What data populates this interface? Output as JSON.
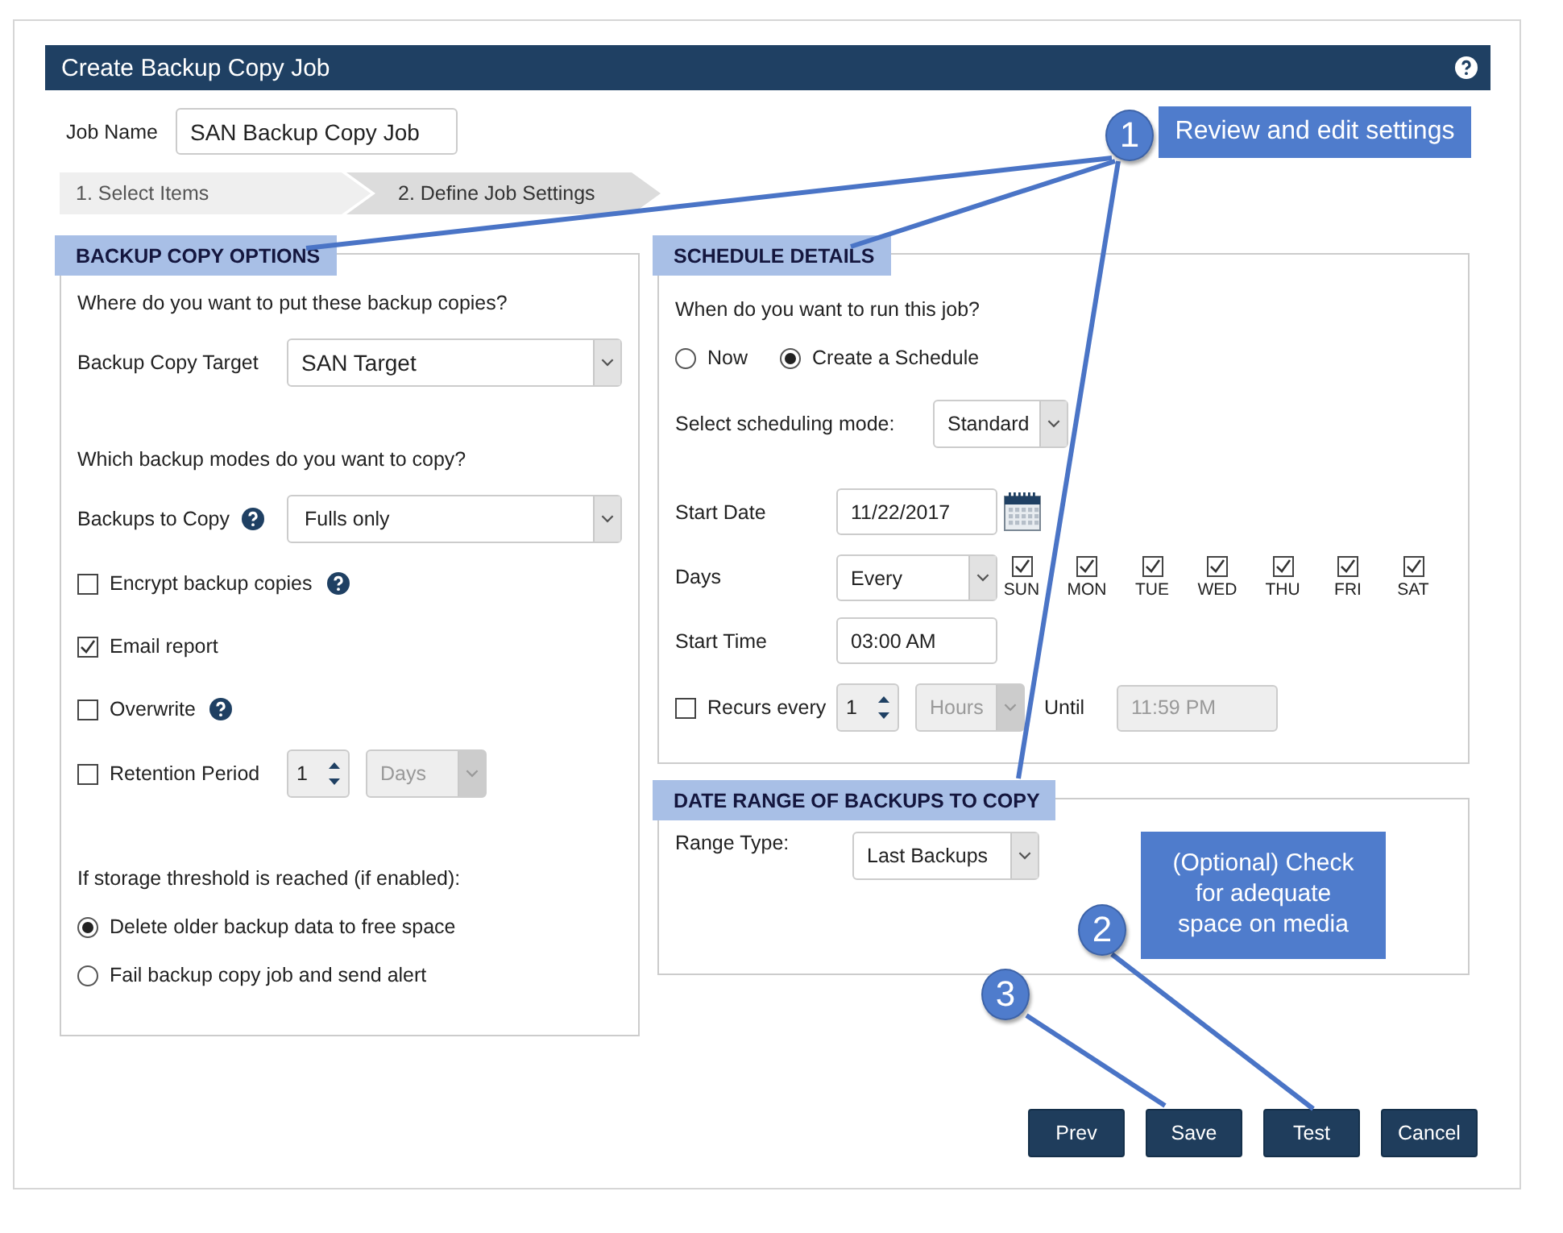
{
  "window": {
    "title": "Create Backup Copy Job"
  },
  "job_name": {
    "label": "Job Name",
    "value": "SAN Backup Copy Job"
  },
  "steps": [
    {
      "label": "1. Select Items",
      "selected": false
    },
    {
      "label": "2. Define Job Settings",
      "selected": true
    }
  ],
  "backup_copy_options": {
    "title": "BACKUP COPY OPTIONS",
    "target_question": "Where do you want to put these backup copies?",
    "target": {
      "label": "Backup Copy Target",
      "value": "SAN Target"
    },
    "modes_question": "Which backup modes do you want to copy?",
    "backups_to_copy": {
      "label": "Backups to Copy",
      "value": "Fulls only",
      "help": true
    },
    "options": [
      {
        "label": "Encrypt backup copies",
        "checked": false,
        "help": true
      },
      {
        "label": "Email report",
        "checked": true,
        "help": false
      },
      {
        "label": "Overwrite",
        "checked": false,
        "help": true
      }
    ],
    "retention": {
      "label": "Retention Period",
      "checked": false,
      "count": "1",
      "unit": "Days",
      "disabled": true
    },
    "threshold_question": "If storage threshold is reached (if enabled):",
    "threshold_choices": [
      {
        "label": "Delete older backup data to free space",
        "selected": true
      },
      {
        "label": "Fail backup copy job and send alert",
        "selected": false
      }
    ]
  },
  "schedule_details": {
    "title": "SCHEDULE DETAILS",
    "question": "When do you want to run this job?",
    "run_choices": [
      {
        "label": "Now",
        "selected": false
      },
      {
        "label": "Create a Schedule",
        "selected": true
      }
    ],
    "mode": {
      "label": "Select scheduling mode:",
      "value": "Standard"
    },
    "start_date": {
      "label": "Start Date",
      "value": "11/22/2017"
    },
    "days": {
      "label": "Days",
      "value": "Every",
      "items": [
        {
          "label": "SUN",
          "checked": true
        },
        {
          "label": "MON",
          "checked": true
        },
        {
          "label": "TUE",
          "checked": true
        },
        {
          "label": "WED",
          "checked": true
        },
        {
          "label": "THU",
          "checked": true
        },
        {
          "label": "FRI",
          "checked": true
        },
        {
          "label": "SAT",
          "checked": true
        }
      ]
    },
    "start_time": {
      "label": "Start Time",
      "value": "03:00 AM"
    },
    "recurs": {
      "label": "Recurs every",
      "checked": false,
      "count": "1",
      "unit": "Hours",
      "disabled": true,
      "until_label": "Until",
      "until_value": "11:59 PM"
    }
  },
  "date_range": {
    "title": "DATE RANGE OF BACKUPS TO COPY",
    "range_type": {
      "label": "Range Type:",
      "value": "Last Backups"
    }
  },
  "buttons": [
    "Prev",
    "Save",
    "Test",
    "Cancel"
  ],
  "annotations": [
    {
      "number": "1",
      "text": "Review and edit settings"
    },
    {
      "number": "2",
      "text": "(Optional) Check for adequate space on media"
    },
    {
      "number": "3"
    }
  ]
}
